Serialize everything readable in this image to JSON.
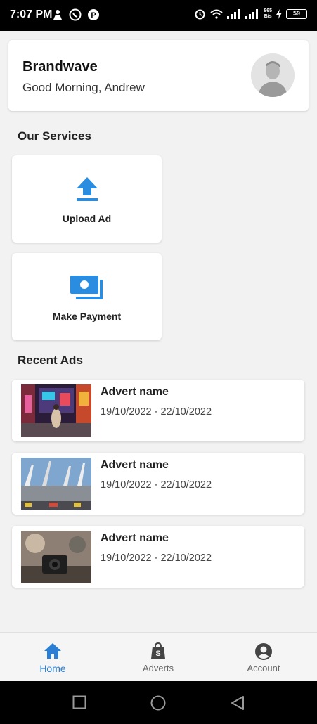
{
  "status_bar": {
    "time": "7:07 PM",
    "speed_top": "865",
    "speed_bottom": "B/s",
    "battery": "59"
  },
  "header": {
    "brand": "Brandwave",
    "greeting": "Good Morning, Andrew"
  },
  "services": {
    "title": "Our Services",
    "items": [
      {
        "label": "Upload Ad",
        "icon": "upload-icon"
      },
      {
        "label": "Make Payment",
        "icon": "payment-icon"
      }
    ]
  },
  "recent_ads": {
    "title": "Recent Ads",
    "items": [
      {
        "name": "Advert name",
        "dates": "19/10/2022 - 22/10/2022"
      },
      {
        "name": "Advert name",
        "dates": "19/10/2022 - 22/10/2022"
      },
      {
        "name": "Advert name",
        "dates": "19/10/2022 - 22/10/2022"
      }
    ]
  },
  "bottom_nav": {
    "items": [
      {
        "label": "Home",
        "icon": "home-icon",
        "active": true
      },
      {
        "label": "Adverts",
        "icon": "shopping-bag-icon",
        "active": false
      },
      {
        "label": "Account",
        "icon": "account-icon",
        "active": false
      }
    ]
  },
  "colors": {
    "accent": "#2a7fd4",
    "background": "#f2f2f2"
  }
}
